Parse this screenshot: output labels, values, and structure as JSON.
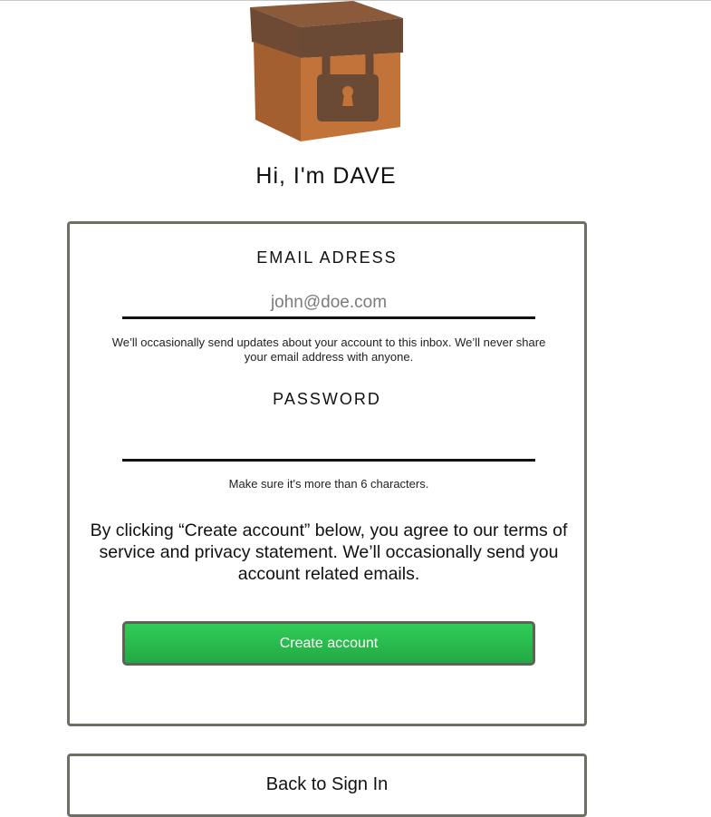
{
  "logo": {
    "icon": "locked-box-icon"
  },
  "greeting": "Hi, I'm DAVE",
  "signup": {
    "email": {
      "label": "EMAIL ADRESS",
      "placeholder": "john@doe.com",
      "value": "",
      "hint": "We’ll occasionally send updates about your account to this inbox. We’ll never share your email address with anyone."
    },
    "password": {
      "label": "PASSWORD",
      "placeholder": "",
      "value": "",
      "hint": "Make sure it's more than 6 characters."
    },
    "terms": "By clicking “Create account” below, you agree to our terms of service and privacy statement. We’ll occasionally send you account related emails.",
    "create_button": "Create account"
  },
  "signin": {
    "link": "Back to Sign In"
  },
  "colors": {
    "button_top": "#30cd57",
    "button_bottom": "#23a944",
    "card_border": "#6e6e64",
    "box_lid": "#6b4a35",
    "box_body": "#c1733a",
    "lock": "#6b4a35"
  }
}
